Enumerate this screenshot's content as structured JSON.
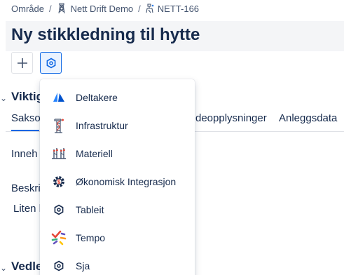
{
  "breadcrumb": {
    "items": [
      "Område",
      "Nett Drift Demo",
      "NETT-166"
    ],
    "separator": "/"
  },
  "page": {
    "title": "Ny stikkledning til hytte"
  },
  "toolbar": {
    "buttons": [
      {
        "icon": "plus-icon"
      },
      {
        "icon": "app-hexagon-icon",
        "active": true
      }
    ]
  },
  "background": {
    "section1_heading": "Viktig",
    "tabs": [
      {
        "label": "Sakso",
        "active": true
      },
      {
        "label": "deopplysninger"
      },
      {
        "label": "Anleggsdata"
      }
    ],
    "field1_label": "Inneh",
    "field2_label": "Beskri",
    "field2_value": "Liten l",
    "section2_heading": "Vedle"
  },
  "menu": {
    "items": [
      {
        "label": "Deltakere",
        "icon": "deltakere-icon"
      },
      {
        "label": "Infrastruktur",
        "icon": "infrastruktur-icon"
      },
      {
        "label": "Materiell",
        "icon": "materiell-icon"
      },
      {
        "label": "Økonomisk Integrasjon",
        "icon": "okonomisk-integrasjon-icon"
      },
      {
        "label": "Tableit",
        "icon": "hexagon-icon"
      },
      {
        "label": "Tempo",
        "icon": "tempo-icon"
      },
      {
        "label": "Sja",
        "icon": "hexagon-icon"
      }
    ]
  },
  "colors": {
    "accent": "#0c66e4",
    "text": "#172b4d",
    "subtle": "#44546f"
  }
}
